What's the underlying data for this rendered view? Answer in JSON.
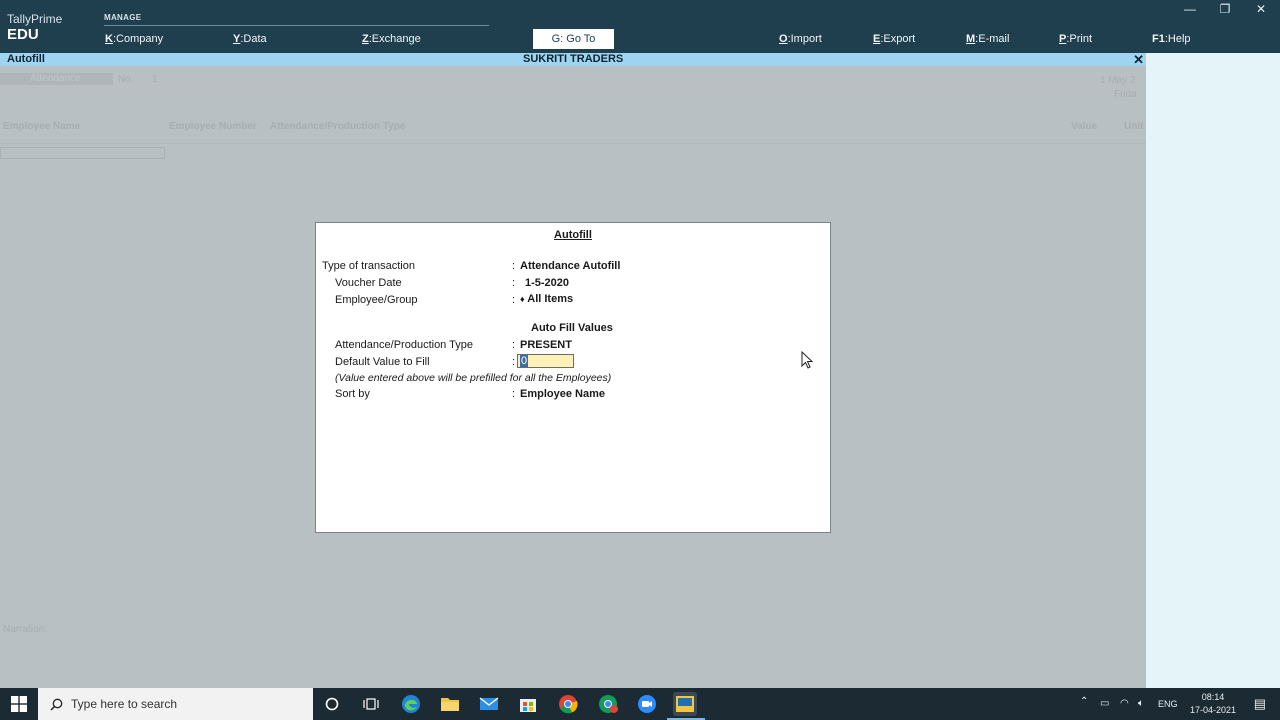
{
  "app": {
    "brand_line1": "TallyPrime",
    "brand_line2": "EDU",
    "menu_group": "MANAGE"
  },
  "menu": {
    "company": {
      "key": "K",
      "label": "Company"
    },
    "data": {
      "key": "Y",
      "label": "Data"
    },
    "exchange": {
      "key": "Z",
      "label": "Exchange"
    },
    "goto": {
      "key": "G",
      "label": "Go To"
    },
    "import": {
      "key": "O",
      "label": "Import"
    },
    "export": {
      "key": "E",
      "label": "Export"
    },
    "email": {
      "key": "M",
      "label": "E-mail"
    },
    "print": {
      "key": "P",
      "label": "Print"
    },
    "help": {
      "key": "F1",
      "label": "Help"
    }
  },
  "window_controls": {
    "minimize": "—",
    "restore": "❐",
    "close": "✕"
  },
  "titlebar": {
    "screen": "Autofill",
    "company": "SUKRITI TRADERS",
    "close": "✕"
  },
  "background_voucher": {
    "type": "Attendance",
    "no_label": "No.",
    "no_value": "1",
    "date": "1 May 2",
    "day": "Frida",
    "col_employee_name": "Employee Name",
    "col_employee_number": "Employee Number",
    "col_att_type": "Attendance/Production Type",
    "col_value": "Value",
    "col_unit": "Unit",
    "narration": "Narration:"
  },
  "dialog": {
    "title": "Autofill",
    "type_label": "Type of transaction",
    "type_value": "Attendance Autofill",
    "date_label": "Voucher Date",
    "date_value": "1-5-2020",
    "group_label": "Employee/Group",
    "group_bullet": "♦",
    "group_value": "All Items",
    "section_title": "Auto Fill Values",
    "att_type_label": "Attendance/Production Type",
    "att_type_value": "PRESENT",
    "default_label": "Default Value to Fill",
    "default_value": "0",
    "note": "(Value entered above will be prefilled for all the Employees)",
    "sort_label": "Sort by",
    "sort_value": "Employee Name",
    "colon": ":"
  },
  "taskbar": {
    "search_placeholder": "Type here to search",
    "lang": "ENG",
    "time": "08:14",
    "date": "17-04-2021"
  }
}
